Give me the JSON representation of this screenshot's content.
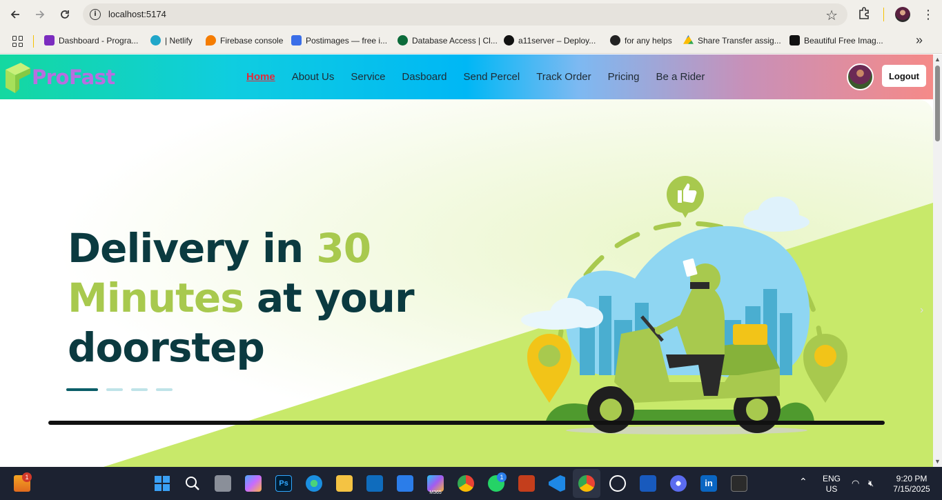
{
  "browser": {
    "url": "localhost:5174",
    "bookmarks": [
      {
        "label": "Dashboard - Progra...",
        "color": "#7b2cbf"
      },
      {
        "label": "| Netlify",
        "color": "#20a6c9"
      },
      {
        "label": "Firebase console",
        "color": "#f57c00"
      },
      {
        "label": "Postimages — free i...",
        "color": "#3a6ee8"
      },
      {
        "label": "Database Access | Cl...",
        "color": "#0b6b3a"
      },
      {
        "label": "a11server – Deploy...",
        "color": "#111111"
      },
      {
        "label": "for any helps",
        "color": "#222222"
      },
      {
        "label": "Share Transfer assig...",
        "color": "#1a73e8"
      },
      {
        "label": "Beautiful Free Imag...",
        "color": "#111111"
      }
    ]
  },
  "site": {
    "logo_text": "ProFast",
    "nav": [
      "Home",
      "About Us",
      "Service",
      "Dasboard",
      "Send Percel",
      "Track Order",
      "Pricing",
      "Be a Rider"
    ],
    "active_nav": "Home",
    "logout_label": "Logout"
  },
  "hero": {
    "line1_a": "Delivery in ",
    "line1_b": "30",
    "line2_a": "Minutes",
    "line2_b": " at your",
    "line3": "doorstep",
    "slide_count": 4,
    "active_slide": 1
  },
  "taskbar": {
    "widget_badge": "1",
    "whatsapp_badge": "1",
    "lang": "ENG",
    "region": "US",
    "time": "9:20 PM",
    "date": "7/15/2025",
    "m365_label": "M365"
  }
}
